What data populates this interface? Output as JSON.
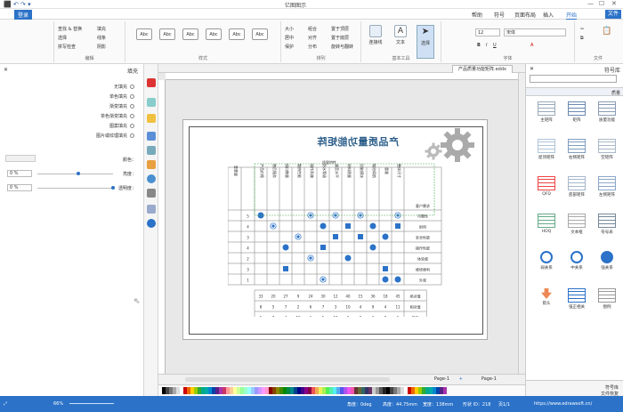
{
  "window": {
    "title": "亿图图示"
  },
  "menu": {
    "file": "文件",
    "items": [
      "开始",
      "插入",
      "页面布局",
      "符号",
      "帮助"
    ],
    "help": "帮助",
    "login": "登录"
  },
  "ribbon": {
    "groups": {
      "clipboard": "文件",
      "font": "字体",
      "basic": "基本工具",
      "arrange": "排列",
      "styles": "样式",
      "edit": "编辑"
    },
    "tools": [
      "选择",
      "文本",
      "连接线"
    ],
    "font_name": "宋体",
    "font_size": "12",
    "style_label": "Abc",
    "fill": "填充",
    "line": "线条",
    "shadow": "阴影",
    "find_replace": "查找 & 替换",
    "select": "选择",
    "spell": "拼写检查",
    "layer_up": "置于顶层",
    "layer_down": "置于底层",
    "group": "组合",
    "align": "对齐",
    "distribute": "分布",
    "position": "位置",
    "size": "大小",
    "rotate": "旋转与翻转",
    "center": "居中",
    "protect": "保护"
  },
  "left_panel": {
    "title": "填充",
    "options": [
      "无填充",
      "单色填充",
      "渐变填充",
      "单色渐变填充",
      "图案填充",
      "图片或纹理填充"
    ],
    "color_label": "颜色：",
    "shade_label": "亮度：",
    "shade_value": "0 %",
    "transparency_label": "透明度：",
    "transparency_value": "0 %"
  },
  "document": {
    "tab": "产品质量功能矩阵.eddx",
    "title": "产品质量功能矩阵",
    "subtitle": "质量特性",
    "row_header": "客户需求",
    "rows": [
      "可靠性",
      "耐用",
      "安全性能",
      "操作性能",
      "体验感",
      "维修便利",
      "外观"
    ],
    "cols": [
      "整体尺寸",
      "重量",
      "电池续航",
      "功能模块",
      "材料质量",
      "噪音水平",
      "防水等级",
      "操作系统",
      "散热性能",
      "接口数量",
      "售后服务",
      "产品价格"
    ],
    "importance_label": "重要度",
    "importance": [
      "5",
      "4",
      "3",
      "4",
      "2",
      "3",
      "1"
    ],
    "footer_rows": [
      "绝对值",
      "相对值",
      "排序"
    ],
    "footer_values": [
      [
        "45",
        "18",
        "36",
        "15",
        "40",
        "12",
        "30",
        "24",
        "9",
        "27",
        "20",
        "33"
      ],
      [
        "11",
        "4",
        "9",
        "4",
        "10",
        "3",
        "7",
        "6",
        "2",
        "7",
        "5",
        "8"
      ],
      [
        "1",
        "8",
        "3",
        "9",
        "2",
        "10",
        "5",
        "6",
        "12",
        "4",
        "7",
        "5"
      ]
    ]
  },
  "pages": {
    "current": "Page-1",
    "tab": "Page-1"
  },
  "right_panel": {
    "title": "符号库",
    "section": "质量",
    "shapes": [
      "质量功能",
      "矩阵",
      "主矩阵",
      "空矩阵",
      "右侧矩阵",
      "屋顶矩阵",
      "左侧矩阵",
      "底部矩阵",
      "QFD",
      "符号表",
      "文本框",
      "HOQ",
      "强关系",
      "中关系",
      "弱关系",
      "图例",
      "强正相关",
      "箭头"
    ],
    "bottom_tabs": [
      "符号库",
      "文件恢复"
    ]
  },
  "status": {
    "url": "https://www.edrawsoft.cn/",
    "page": "页1/1",
    "shape_id": "形状 ID：218",
    "width": "宽度：138mm",
    "height": "高度：44.75mm",
    "angle": "角度：0deg",
    "zoom": "66%"
  },
  "colors": {
    "accent": "#2b72c8",
    "title": "#2c5e8a"
  }
}
